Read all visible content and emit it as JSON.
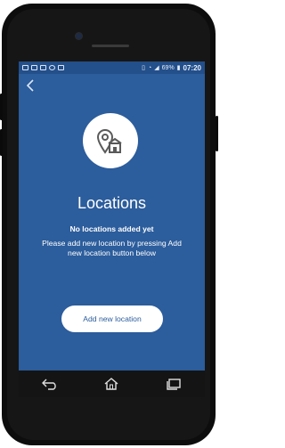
{
  "status_bar": {
    "battery": "69%",
    "time": "07:20"
  },
  "content": {
    "title": "Locations",
    "empty_title": "No locations added yet",
    "empty_message": "Please add new location by pressing Add new location button below",
    "add_button_label": "Add new location"
  },
  "colors": {
    "background": "#2c5d9c",
    "button": "#ffffff"
  },
  "icons": {
    "back": "back-arrow-icon",
    "location": "location-pin-icon",
    "nav": [
      "back-nav-icon",
      "home-nav-icon",
      "recent-apps-icon"
    ]
  }
}
